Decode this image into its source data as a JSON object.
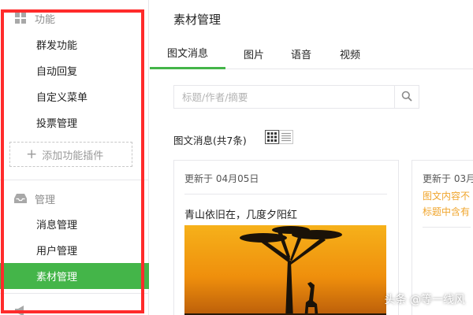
{
  "sidebar": {
    "section_function": {
      "title": "功能",
      "icon": "grid-icon"
    },
    "function_items": [
      {
        "label": "群发功能"
      },
      {
        "label": "自动回复"
      },
      {
        "label": "自定义菜单"
      },
      {
        "label": "投票管理"
      }
    ],
    "add_plugin_label": "添加功能插件",
    "section_manage": {
      "title": "管理",
      "icon": "inbox-icon"
    },
    "manage_items": [
      {
        "label": "消息管理"
      },
      {
        "label": "用户管理"
      },
      {
        "label": "素材管理",
        "active": true
      }
    ],
    "highlight_color": "#ff2b2b"
  },
  "main": {
    "title": "素材管理",
    "tabs": [
      {
        "label": "图文消息",
        "active": true
      },
      {
        "label": "图片"
      },
      {
        "label": "语音"
      },
      {
        "label": "视频"
      }
    ],
    "search": {
      "placeholder": "标题/作者/摘要"
    },
    "count_label": "图文消息(共7条)",
    "view_modes": [
      "grid-view-icon",
      "list-view-icon"
    ],
    "cards": [
      {
        "date": "更新于 04月05日",
        "title": "青山依旧在，几度夕阳红",
        "image": "sunset-tree-giraffe-image"
      },
      {
        "date": "更新于 03月",
        "lines": [
          "图文内容不",
          "标题中含有"
        ]
      }
    ]
  },
  "watermark": "头条 @等一线风",
  "colors": {
    "accent": "#44b549",
    "warning": "#f0a52c",
    "border": "#e7e7eb"
  }
}
